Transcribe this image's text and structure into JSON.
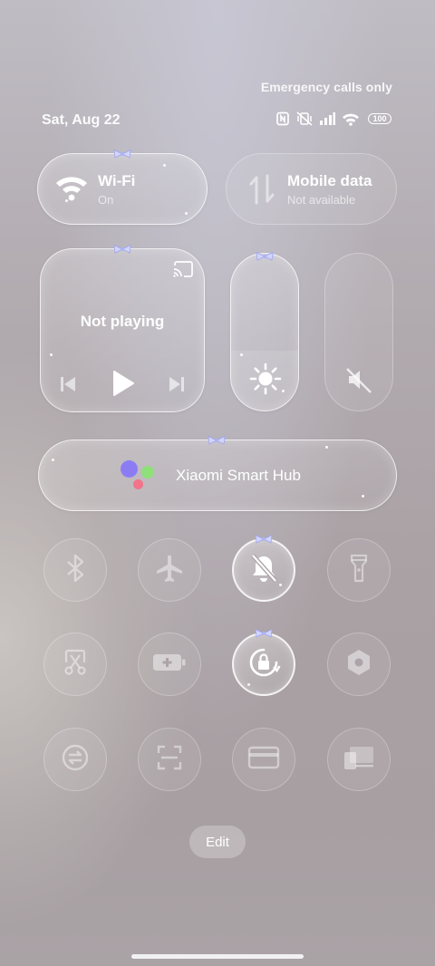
{
  "status_bar": {
    "emergency_text": "Emergency calls only",
    "date": "Sat, Aug 22",
    "battery": "100",
    "icons": [
      "nfc-icon",
      "vibrate-off-icon",
      "signal-icon",
      "wifi-icon",
      "battery-icon"
    ]
  },
  "tiles": {
    "wifi": {
      "title": "Wi-Fi",
      "status": "On",
      "active": true
    },
    "mobile_data": {
      "title": "Mobile data",
      "status": "Not available",
      "active": false
    }
  },
  "media": {
    "status": "Not playing",
    "icons": [
      "cast-icon",
      "previous-icon",
      "play-icon",
      "next-icon"
    ]
  },
  "sliders": {
    "brightness": {
      "icon": "brightness-icon"
    },
    "volume": {
      "icon": "volume-mute-icon"
    }
  },
  "smart_hub": {
    "label": "Xiaomi Smart Hub"
  },
  "toggles": [
    {
      "name": "bluetooth",
      "icon": "bluetooth-icon",
      "active": false
    },
    {
      "name": "airplane-mode",
      "icon": "airplane-icon",
      "active": false
    },
    {
      "name": "mute",
      "icon": "bell-off-icon",
      "active": true
    },
    {
      "name": "flashlight",
      "icon": "flashlight-icon",
      "active": false
    },
    {
      "name": "screenshot",
      "icon": "scissors-icon",
      "active": false
    },
    {
      "name": "battery-saver",
      "icon": "battery-plus-icon",
      "active": false
    },
    {
      "name": "rotation-lock",
      "icon": "rotation-lock-icon",
      "active": true
    },
    {
      "name": "settings",
      "icon": "hexagon-icon",
      "active": false
    },
    {
      "name": "sync",
      "icon": "sync-icon",
      "active": false
    },
    {
      "name": "scanner",
      "icon": "scan-icon",
      "active": false
    },
    {
      "name": "card",
      "icon": "card-icon",
      "active": false
    },
    {
      "name": "screen-cast",
      "icon": "devices-icon",
      "active": false
    }
  ],
  "edit_label": "Edit",
  "colors": {
    "accent_white": "#ffffff",
    "bow": "#c9cdf7",
    "hub_purple": "#8c7cf4",
    "hub_green": "#8ee07a",
    "hub_red": "#f2738a"
  }
}
